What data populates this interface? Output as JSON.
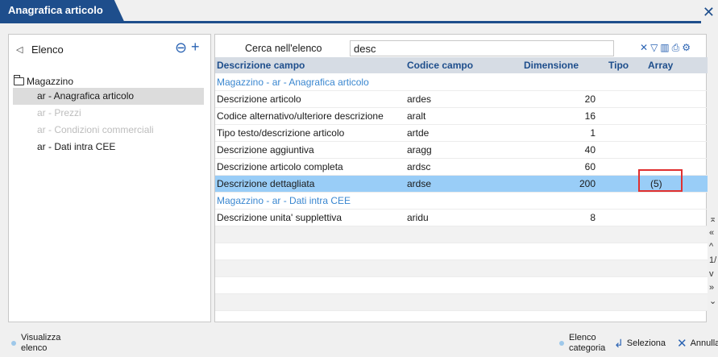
{
  "window": {
    "title": "Anagrafica articolo"
  },
  "left_panel": {
    "title": "Elenco",
    "root": "Magazzino",
    "items": [
      {
        "label": "ar - Anagrafica articolo",
        "state": "selected"
      },
      {
        "label": "ar - Prezzi",
        "state": "disabled"
      },
      {
        "label": "ar - Condizioni commerciali",
        "state": "disabled"
      },
      {
        "label": "ar - Dati intra CEE",
        "state": "normal"
      }
    ]
  },
  "search": {
    "label": "Cerca nell'elenco",
    "value": "desc"
  },
  "grid": {
    "headers": {
      "desc": "Descrizione campo",
      "code": "Codice campo",
      "dim": "Dimensione",
      "type": "Tipo",
      "array": "Array"
    },
    "rows": [
      {
        "kind": "group",
        "desc": "Magazzino - ar - Anagrafica articolo"
      },
      {
        "kind": "data",
        "desc": "Descrizione articolo",
        "code": "ardes",
        "dim": "20",
        "array": ""
      },
      {
        "kind": "data",
        "desc": "Codice alternativo/ulteriore descrizione",
        "code": "aralt",
        "dim": "16",
        "array": ""
      },
      {
        "kind": "data",
        "desc": "Tipo testo/descrizione articolo",
        "code": "artde",
        "dim": "1",
        "array": ""
      },
      {
        "kind": "data",
        "desc": "Descrizione aggiuntiva",
        "code": "aragg",
        "dim": "40",
        "array": ""
      },
      {
        "kind": "data",
        "desc": "Descrizione articolo completa",
        "code": "ardsc",
        "dim": "60",
        "array": ""
      },
      {
        "kind": "selected",
        "desc": "Descrizione dettagliata",
        "code": "ardse",
        "dim": "200",
        "array": "(5)"
      },
      {
        "kind": "group",
        "desc": "Magazzino - ar - Dati intra CEE"
      },
      {
        "kind": "data",
        "desc": "Descrizione unita' supplettiva",
        "code": "aridu",
        "dim": "8",
        "array": ""
      }
    ]
  },
  "pager": {
    "label": "1/"
  },
  "bottom_bar": {
    "visualizza": "Visualizza\nelenco",
    "elenco_categoria": "Elenco\ncategoria",
    "seleziona": "Seleziona",
    "annulla": "Annulla"
  },
  "colors": {
    "accent": "#1e4e8c",
    "selected_row": "#99cdf7",
    "group_text": "#3a87d0",
    "highlight_box": "#e03030"
  }
}
